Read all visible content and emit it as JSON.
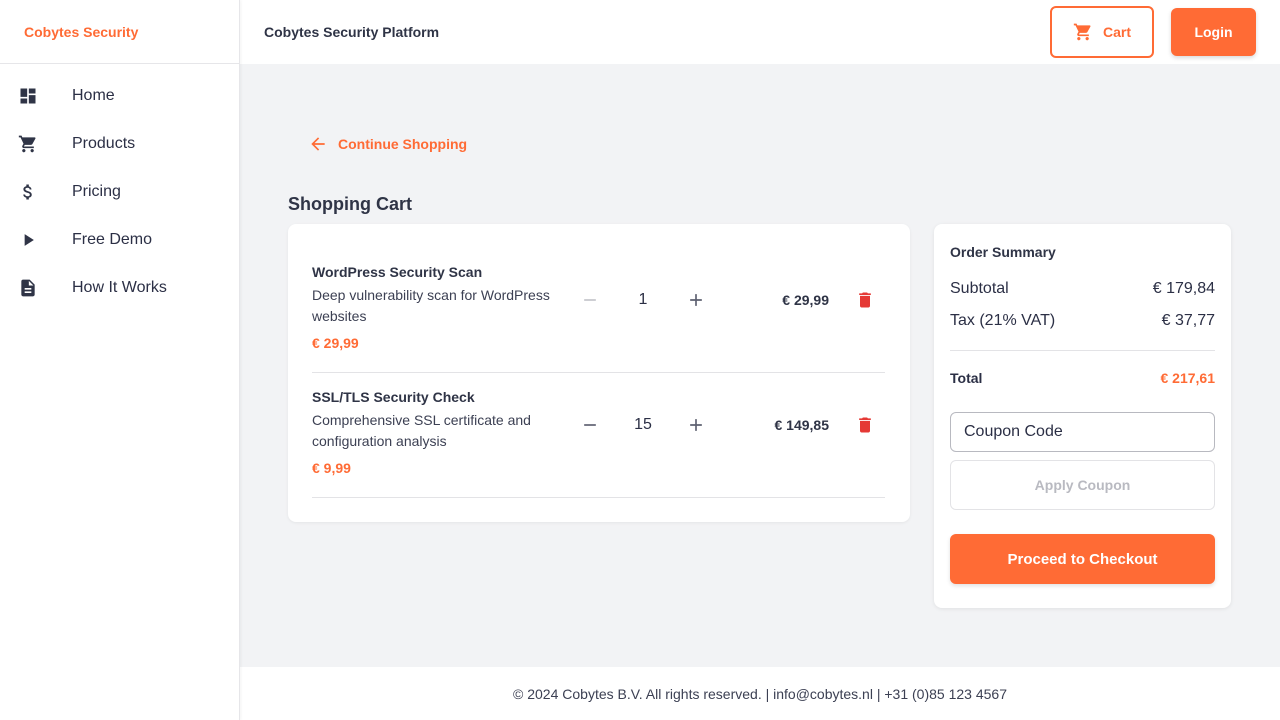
{
  "brand": "Cobytes Security",
  "sidebar": {
    "items": [
      {
        "label": "Home",
        "icon": "dashboard-icon"
      },
      {
        "label": "Products",
        "icon": "cart-icon"
      },
      {
        "label": "Pricing",
        "icon": "dollar-icon"
      },
      {
        "label": "Free Demo",
        "icon": "play-icon"
      },
      {
        "label": "How It Works",
        "icon": "document-icon"
      }
    ]
  },
  "header": {
    "title": "Cobytes Security Platform",
    "cart_label": "Cart",
    "login_label": "Login"
  },
  "main": {
    "continue_label": "Continue Shopping",
    "cart_title": "Shopping Cart",
    "items": [
      {
        "name": "WordPress Security Scan",
        "description": "Deep vulnerability scan for WordPress websites",
        "unit_price": "€ 29,99",
        "quantity": "1",
        "total": "€ 29,99"
      },
      {
        "name": "SSL/TLS Security Check",
        "description": "Comprehensive SSL certificate and configuration analysis",
        "unit_price": "€ 9,99",
        "quantity": "15",
        "total": "€ 149,85"
      }
    ]
  },
  "summary": {
    "title": "Order Summary",
    "subtotal_label": "Subtotal",
    "subtotal_value": "€ 179,84",
    "tax_label": "Tax (21% VAT)",
    "tax_value": "€ 37,77",
    "total_label": "Total",
    "total_value": "€ 217,61",
    "coupon_placeholder": "Coupon Code",
    "apply_label": "Apply Coupon",
    "checkout_label": "Proceed to Checkout"
  },
  "footer": {
    "text": "© 2024 Cobytes B.V. All rights reserved. | info@cobytes.nl | +31 (0)85 123 4567"
  },
  "colors": {
    "accent": "#ff6b35",
    "danger": "#e53935",
    "background": "#f2f3f5"
  }
}
